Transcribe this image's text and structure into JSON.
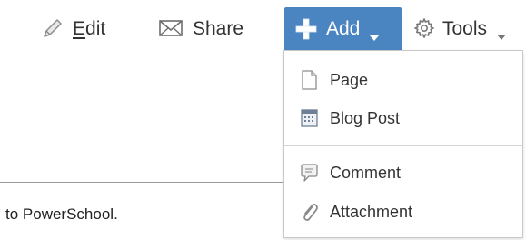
{
  "toolbar": {
    "edit": {
      "label_underlined": "E",
      "label_rest": "dit",
      "icon": "pencil-icon"
    },
    "share": {
      "label": "Share",
      "icon": "mail-icon"
    },
    "add": {
      "label": "Add",
      "icon": "plus-icon",
      "accent": "#4b85c1",
      "expanded": true
    },
    "tools": {
      "label": "Tools",
      "icon": "gear-icon"
    }
  },
  "content": {
    "text": "to PowerSchool."
  },
  "add_menu": {
    "items": [
      {
        "label": "Page",
        "icon": "page-icon"
      },
      {
        "label": "Blog Post",
        "icon": "blog-post-icon"
      },
      {
        "label": "Comment",
        "icon": "comment-icon"
      },
      {
        "label": "Attachment",
        "icon": "paperclip-icon"
      }
    ]
  }
}
